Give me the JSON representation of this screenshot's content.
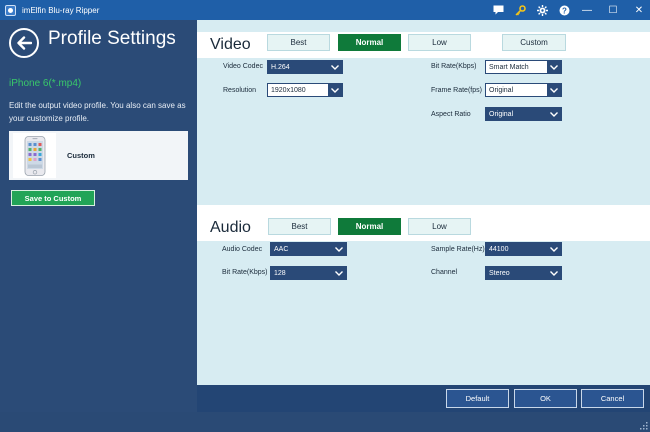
{
  "window": {
    "title": "imElfin Blu-ray Ripper",
    "icons": [
      "chat-icon",
      "key-icon",
      "gear-icon",
      "help-icon"
    ],
    "minimize_glyph": "—",
    "maximize_glyph": "☐",
    "close_glyph": "✕"
  },
  "left": {
    "title": "Profile Settings",
    "profile_name": "iPhone 6(*.mp4)",
    "description": "Edit the output video profile. You also can save as your customize profile.",
    "card_label": "Custom",
    "save_button": "Save to Custom"
  },
  "video": {
    "label": "Video",
    "presets": [
      "Best",
      "Normal",
      "Low",
      "Custom"
    ],
    "active_preset": "Normal",
    "fields": {
      "codec_label": "Video Codec",
      "codec_value": "H.264",
      "resolution_label": "Resolution",
      "resolution_value": "1920x1080",
      "bitrate_label": "Bit Rate(Kbps)",
      "bitrate_value": "Smart Match",
      "framerate_label": "Frame Rate(fps)",
      "framerate_value": "Original",
      "aspect_label": "Aspect Ratio",
      "aspect_value": "Original"
    }
  },
  "audio": {
    "label": "Audio",
    "presets": [
      "Best",
      "Normal",
      "Low"
    ],
    "active_preset": "Normal",
    "fields": {
      "codec_label": "Audio Codec",
      "codec_value": "AAC",
      "bitrate_label": "Bit Rate(Kbps)",
      "bitrate_value": "128",
      "samplerate_label": "Sample Rate(Hz)",
      "samplerate_value": "44100",
      "channel_label": "Channel",
      "channel_value": "Stereo"
    }
  },
  "footer": {
    "default_button": "Default",
    "ok_button": "OK",
    "cancel_button": "Cancel"
  },
  "colors": {
    "accent_green": "#0f7a3a",
    "titlebar": "#1f5fa8",
    "panel_dark": "#2b4b77",
    "panel_light": "#d7ecf2"
  }
}
